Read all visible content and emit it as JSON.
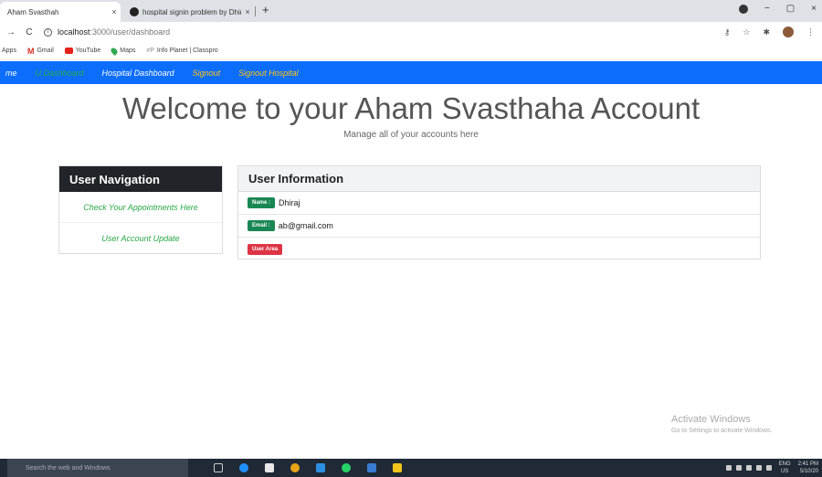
{
  "browser": {
    "tabs": [
      {
        "title": "Aham Svasthah",
        "close": "×"
      },
      {
        "title": "hospital signin problem by Dhira",
        "close": "×"
      }
    ],
    "new_tab": "+",
    "window_controls": {
      "minimize": "−",
      "maximize": "▢",
      "close": "×"
    },
    "url": {
      "host": "localhost",
      "path": ":3000/user/dashboard"
    },
    "bookmarks": [
      "Apps",
      "Gmail",
      "YouTube",
      "Maps",
      "Info Planet | Classpro"
    ]
  },
  "navbar": {
    "home": "me",
    "user_dashboard": "U.Dashboard",
    "hospital_dashboard": "Hospital Dashboard",
    "signout": "Signout",
    "signout_hospital": "Signout Hospital",
    "colors": {
      "bg": "#0d6efd",
      "active": "#28a745",
      "warning": "#ffc107"
    }
  },
  "jumbotron": {
    "title": "Welcome to your Aham Svasthaha Account",
    "subtitle": "Manage all of your accounts here"
  },
  "user_navigation": {
    "header": "User Navigation",
    "items": [
      "Check Your Appointments Here",
      "User Account Update"
    ]
  },
  "user_information": {
    "header": "User Information",
    "name_label": "Name :",
    "name": "Dhiraj",
    "email_label": "Email :",
    "email": "ab@gmail.com",
    "user_area": "User Area"
  },
  "watermark": {
    "title": "Activate Windows",
    "subtitle": "Go to Settings to activate Windows."
  },
  "taskbar": {
    "search_placeholder": "Search the web and Windows",
    "lang": "ENG",
    "region": "US",
    "time": "2:41 PM",
    "date": "5/10/20"
  }
}
